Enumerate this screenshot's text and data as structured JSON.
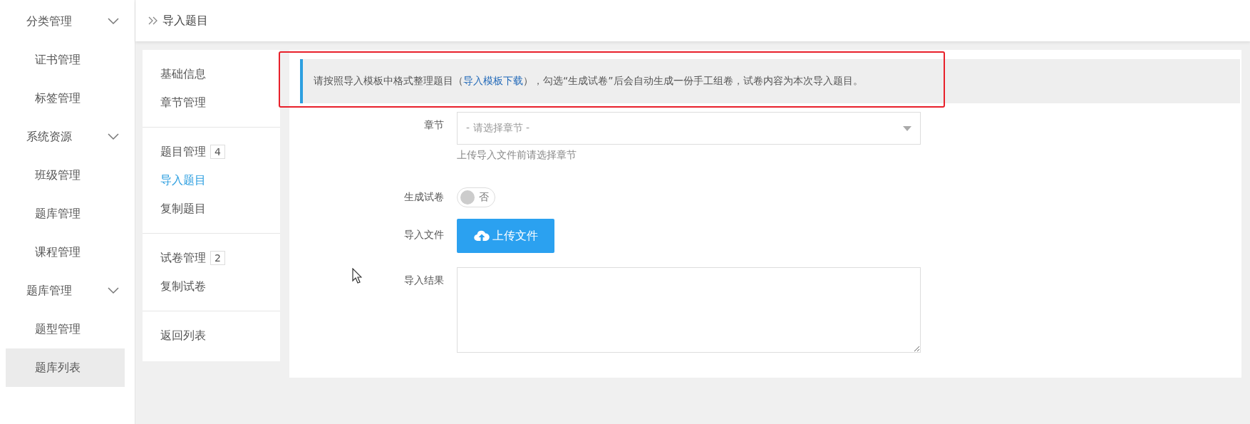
{
  "sidebar": {
    "items": [
      {
        "label": "分类管理",
        "kind": "group",
        "selected": false
      },
      {
        "label": "证书管理",
        "kind": "item",
        "selected": false
      },
      {
        "label": "标签管理",
        "kind": "item",
        "selected": false
      },
      {
        "label": "系统资源",
        "kind": "group",
        "selected": false
      },
      {
        "label": "班级管理",
        "kind": "item",
        "selected": false
      },
      {
        "label": "题库管理",
        "kind": "item",
        "selected": false
      },
      {
        "label": "课程管理",
        "kind": "item",
        "selected": false
      },
      {
        "label": "题库管理",
        "kind": "group",
        "selected": false
      },
      {
        "label": "题型管理",
        "kind": "item",
        "selected": false
      },
      {
        "label": "题库列表",
        "kind": "item",
        "selected": true
      }
    ]
  },
  "breadcrumb": {
    "current": "导入题目"
  },
  "submenu": {
    "sections": [
      {
        "items": [
          {
            "label": "基础信息",
            "selected": false
          },
          {
            "label": "章节管理",
            "selected": false
          }
        ]
      },
      {
        "items": [
          {
            "label": "题目管理",
            "count": "4",
            "selected": false
          },
          {
            "label": "导入题目",
            "selected": true
          },
          {
            "label": "复制题目",
            "selected": false
          }
        ]
      },
      {
        "items": [
          {
            "label": "试卷管理",
            "count": "2",
            "selected": false
          },
          {
            "label": "复制试卷",
            "selected": false
          }
        ]
      },
      {
        "items": [
          {
            "label": "返回列表",
            "selected": false
          }
        ]
      }
    ]
  },
  "notice": {
    "before": "请按照导入模板中格式整理题目（",
    "link": "导入模板下载",
    "after": "），勾选“生成试卷”后会自动生成一份手工组卷，试卷内容为本次导入题目。"
  },
  "form": {
    "chapter": {
      "label": "章节",
      "placeholder": "- 请选择章节 -",
      "hint": "上传导入文件前请选择章节"
    },
    "generate": {
      "label": "生成试卷",
      "on": false,
      "text": "否"
    },
    "file": {
      "label": "导入文件",
      "button": "上传文件"
    },
    "result": {
      "label": "导入结果"
    }
  }
}
